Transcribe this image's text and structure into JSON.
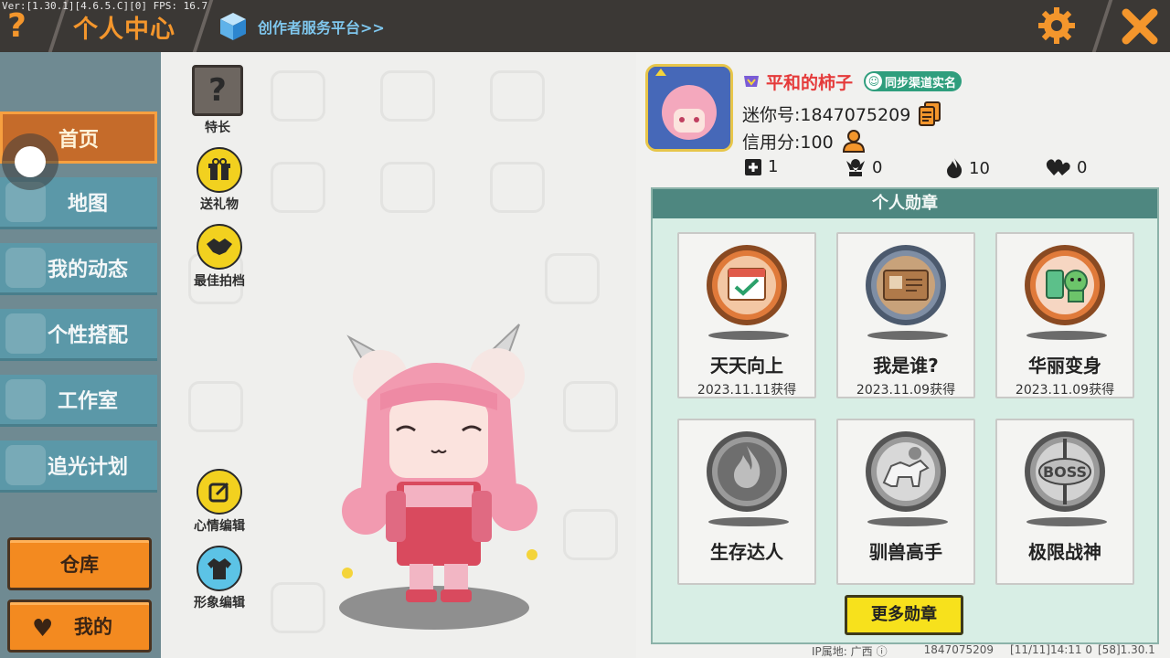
{
  "debug": {
    "text": "Ver:[1.30.1][4.6.5.C][0] FPS: 16.7"
  },
  "header": {
    "title": "个人中心",
    "creator_link": "创作者服务平台>>"
  },
  "nav": {
    "items": [
      {
        "label": "首页",
        "active": true
      },
      {
        "label": "地图"
      },
      {
        "label": "我的动态"
      },
      {
        "label": "个性搭配"
      },
      {
        "label": "工作室"
      },
      {
        "label": "追光计划"
      }
    ],
    "warehouse": "仓库",
    "mine": "我的"
  },
  "side_buttons": {
    "skill": "特长",
    "gift": "送礼物",
    "best_shot": "最佳拍档",
    "mood": "心情编辑",
    "image": "形象编辑"
  },
  "profile": {
    "nickname": "平和的柿子",
    "realname_badge": "同步渠道实名",
    "mini_id": "迷你号:1847075209",
    "credit": "信用分:100",
    "stats": {
      "add": "1",
      "fans": "0",
      "popularity": "10",
      "likes": "0"
    }
  },
  "medals": {
    "title": "个人勋章",
    "items": [
      {
        "name": "天天向上",
        "date": "2023.11.11获得"
      },
      {
        "name": "我是谁?",
        "date": "2023.11.09获得"
      },
      {
        "name": "华丽变身",
        "date": "2023.11.09获得"
      },
      {
        "name": "生存达人",
        "date": ""
      },
      {
        "name": "驯兽高手",
        "date": ""
      },
      {
        "name": "极限战神",
        "date": ""
      }
    ],
    "more": "更多勋章"
  },
  "footer": {
    "ip": "IP属地: 广西",
    "uid": "1847075209",
    "time": "[11/11]14:11 0",
    "version": "[58]1.30.1"
  },
  "colors": {
    "accent": "#f4962c",
    "nav_bg": "#5b98a8",
    "panel_header": "#4e8780",
    "nickname": "#e53a3a"
  }
}
